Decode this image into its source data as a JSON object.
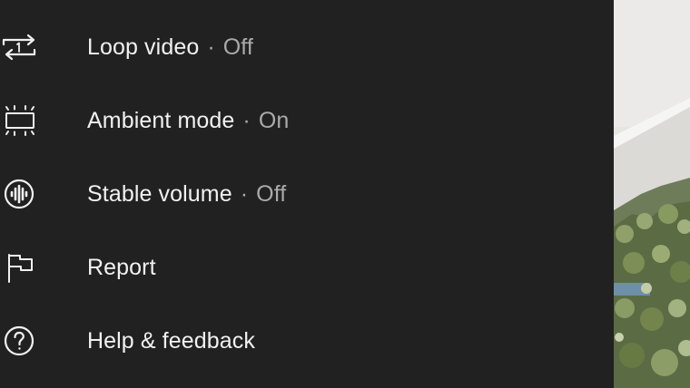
{
  "menu": {
    "items": [
      {
        "icon": "loop-icon",
        "label": "Loop video",
        "separator": "·",
        "state": "Off"
      },
      {
        "icon": "ambient-mode-icon",
        "label": "Ambient mode",
        "separator": "·",
        "state": "On"
      },
      {
        "icon": "stable-volume-icon",
        "label": "Stable volume",
        "separator": "·",
        "state": "Off"
      },
      {
        "icon": "flag-icon",
        "label": "Report"
      },
      {
        "icon": "help-icon",
        "label": "Help & feedback"
      }
    ]
  },
  "colors": {
    "sheet_background": "#212121",
    "label": "#f1f1f1",
    "secondary": "#aaaaaa"
  }
}
